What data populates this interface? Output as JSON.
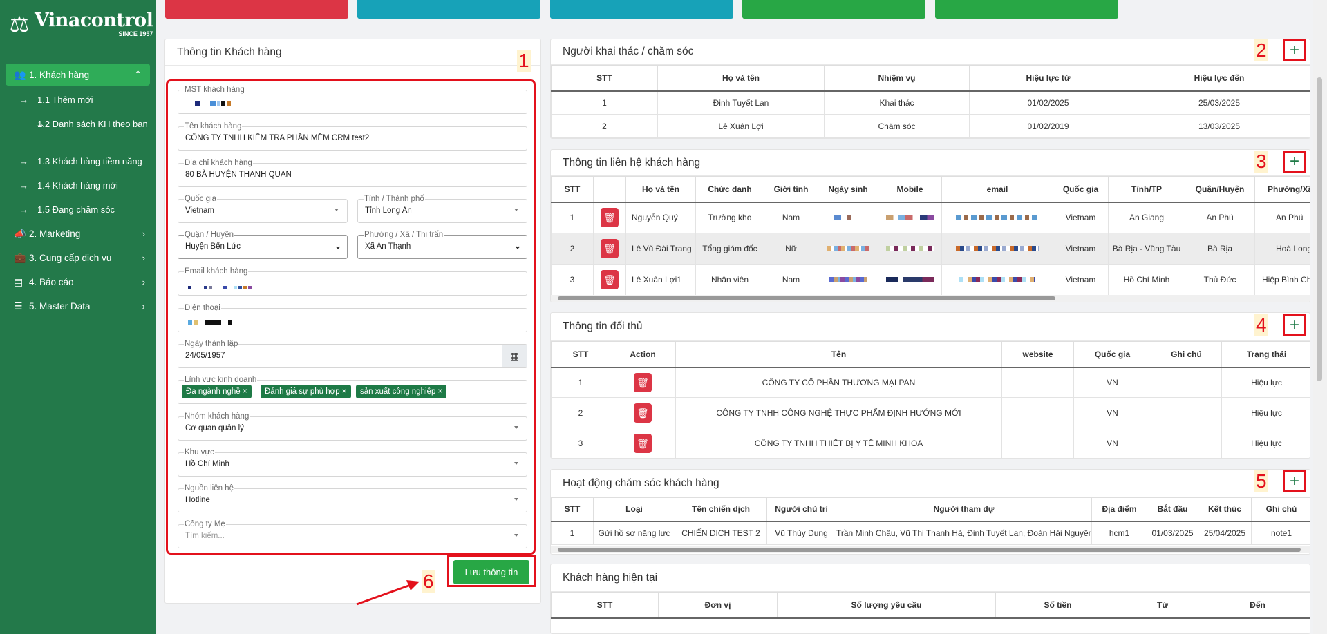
{
  "brand": {
    "name": "Vinacontrol",
    "since": "SINCE 1957"
  },
  "sidebar": {
    "items": [
      {
        "label": "1. Khách hàng",
        "icon": "users-icon"
      },
      {
        "label": "2. Marketing",
        "icon": "bullhorn-icon"
      },
      {
        "label": "3. Cung cấp dịch vụ",
        "icon": "briefcase-icon"
      },
      {
        "label": "4. Báo cáo",
        "icon": "book-icon"
      },
      {
        "label": "5. Master Data",
        "icon": "database-icon"
      }
    ],
    "subitems": [
      "1.1 Thêm mới",
      "1.2 Danh sách KH theo ban",
      "1.3 Khách hàng tiềm năng",
      "1.4 Khách hàng mới",
      "1.5 Đang chăm sóc"
    ]
  },
  "top_buttons": [
    {
      "color": "#dc3545"
    },
    {
      "color": "#17a2b8"
    },
    {
      "color": "#17a2b8"
    },
    {
      "color": "#28a745"
    },
    {
      "color": "#28a745"
    }
  ],
  "customer_form": {
    "title": "Thông tin Khách hàng",
    "tax_code_label": "MST khách hàng",
    "name_label": "Tên khách hàng",
    "name_value": "CÔNG TY TNHH KIỂM TRA PHẦN MỀM CRM test2",
    "address_label": "Địa chỉ khách hàng",
    "address_value": "80 BÀ HUYỆN THANH QUAN",
    "country_label": "Quốc gia",
    "country_value": "Vietnam",
    "province_label": "Tỉnh / Thành phố",
    "province_value": "Tỉnh Long An",
    "district_label": "Quận / Huyện",
    "district_value": "Huyện Bến Lức",
    "ward_label": "Phường / Xã / Thị trấn",
    "ward_value": "Xã An Thạnh",
    "email_label": "Email khách hàng",
    "phone_label": "Điện thoại",
    "founded_label": "Ngày thành lập",
    "founded_value": "24/05/1957",
    "business_label": "Lĩnh vực kinh doanh",
    "business_tags": [
      "Đa ngành nghề ×",
      "Đánh giá sự phù hợp ×",
      "sản xuất công nghiệp ×"
    ],
    "group_label": "Nhóm khách hàng",
    "group_value": "Cơ quan quản lý",
    "region_label": "Khu vực",
    "region_value": "Hồ Chí Minh",
    "source_label": "Nguồn liên hệ",
    "source_value": "Hotline",
    "parent_label": "Công ty Mẹ",
    "parent_placeholder": "Tìm kiếm...",
    "save_label": "Lưu thông tin"
  },
  "markers": {
    "m1": "1",
    "m2": "2",
    "m3": "3",
    "m4": "4",
    "m5": "5",
    "m6": "6"
  },
  "caretakers": {
    "title": "Người khai thác / chăm sóc",
    "headers": [
      "STT",
      "Họ và tên",
      "Nhiệm vụ",
      "Hiệu lực từ",
      "Hiệu lực đến"
    ],
    "rows": [
      [
        "1",
        "Đinh Tuyết Lan",
        "Khai thác",
        "01/02/2025",
        "25/03/2025"
      ],
      [
        "2",
        "Lê Xuân Lợi",
        "Chăm sóc",
        "01/02/2019",
        "13/03/2025"
      ]
    ]
  },
  "contacts": {
    "title": "Thông tin liên hệ khách hàng",
    "headers": [
      "STT",
      "",
      "Họ và tên",
      "Chức danh",
      "Giới tính",
      "Ngày sinh",
      "Mobile",
      "email",
      "Quốc gia",
      "Tỉnh/TP",
      "Quận/Huyện",
      "Phường/Xã"
    ],
    "rows": [
      [
        "1",
        "Nguyễn Quý",
        "Trưởng kho",
        "Nam",
        "Vietnam",
        "An Giang",
        "An Phú",
        "An Phú"
      ],
      [
        "2",
        "Lê Vũ Đài Trang",
        "Tổng giám đốc",
        "Nữ",
        "Vietnam",
        "Bà Rịa - Vũng Tàu",
        "Bà Rịa",
        "Hoà Long"
      ],
      [
        "3",
        "Lê Xuân Lợi1",
        "Nhân viên",
        "Nam",
        "Vietnam",
        "Hồ Chí Minh",
        "Thủ Đức",
        "Hiệp Bình Chá"
      ]
    ]
  },
  "competitors": {
    "title": "Thông tin đối thủ",
    "headers": [
      "STT",
      "Action",
      "Tên",
      "website",
      "Quốc gia",
      "Ghi chú",
      "Trạng thái"
    ],
    "rows": [
      [
        "1",
        "CÔNG TY CỔ PHẦN THƯƠNG MẠI PAN",
        "",
        "VN",
        "",
        "Hiệu lực"
      ],
      [
        "2",
        "CÔNG TY TNHH CÔNG NGHỆ THỰC PHẨM ĐỊNH HƯỚNG MỚI",
        "",
        "VN",
        "",
        "Hiệu lực"
      ],
      [
        "3",
        "CÔNG TY TNHH THIẾT BỊ Y TẾ MINH KHOA",
        "",
        "VN",
        "",
        "Hiệu lực"
      ]
    ]
  },
  "activities": {
    "title": "Hoạt động chăm sóc khách hàng",
    "headers": [
      "STT",
      "Loại",
      "Tên chiến dịch",
      "Người chủ trì",
      "Người tham dự",
      "Địa điểm",
      "Bắt đầu",
      "Kết thúc",
      "Ghi chú"
    ],
    "rows": [
      [
        "1",
        "Gửi hồ sơ năng lực",
        "CHIẾN DỊCH TEST 2",
        "Vũ Thùy Dung",
        "Trần Minh Châu, Vũ Thị Thanh Hà, Đinh Tuyết Lan, Đoàn Hải Nguyên",
        "hcm1",
        "01/03/2025",
        "25/04/2025",
        "note1"
      ]
    ]
  },
  "current_customers": {
    "title": "Khách hàng hiện tại",
    "headers": [
      "STT",
      "Đơn vị",
      "Số lượng yêu cầu",
      "Số tiền",
      "Từ",
      "Đến"
    ]
  }
}
